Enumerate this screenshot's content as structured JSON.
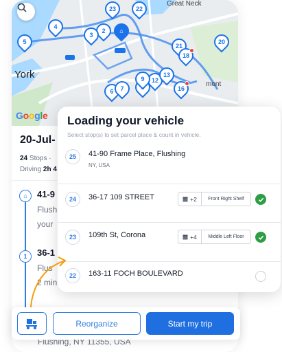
{
  "map": {
    "labels": {
      "york": "York",
      "great_neck": "Great Neck",
      "montauk": "mont"
    },
    "pins": [
      "23",
      "22",
      "4",
      "2",
      "3",
      "5",
      "21",
      "18",
      "20",
      "12",
      "13",
      "6",
      "7",
      "8",
      "9",
      "16"
    ],
    "google": [
      "G",
      "o",
      "o",
      "g",
      "l",
      "e"
    ]
  },
  "summary": {
    "date": "20-Jul-",
    "stops_count": "24",
    "stops_label": "Stops ·",
    "driving_label": "Driving",
    "driving_value": "2h 4"
  },
  "background_stops": [
    {
      "label": "41-9",
      "sub": "Flush",
      "sub2": "your"
    },
    {
      "node": "1",
      "label": "36-1",
      "sub": "Flus",
      "sub2": "2 min"
    }
  ],
  "under_address": "Flushing, NY 11355, USA",
  "card": {
    "title": "Loading your vehicle",
    "subtitle": "Select stop(s) to set parcel place & count in vehicle.",
    "stops": [
      {
        "num": "25",
        "address": "41-90 Frame Place, Flushing",
        "city": "NY, USA"
      },
      {
        "num": "24",
        "address": "36-17 109 STREET",
        "count": "+2",
        "shelf": "Front Right Shelf",
        "checked": true
      },
      {
        "num": "23",
        "address": "109th St, Corona",
        "count": "+4",
        "shelf": "Middle Left Floor",
        "checked": true
      },
      {
        "num": "22",
        "address": "163-11 FOCH BOULEVARD",
        "checked": false
      }
    ]
  },
  "actions": {
    "reorganize": "Reorganize",
    "start": "Start my trip"
  },
  "colors": {
    "primary": "#1f6fe0",
    "check": "#2e9e44",
    "route": "#3b82f6"
  }
}
